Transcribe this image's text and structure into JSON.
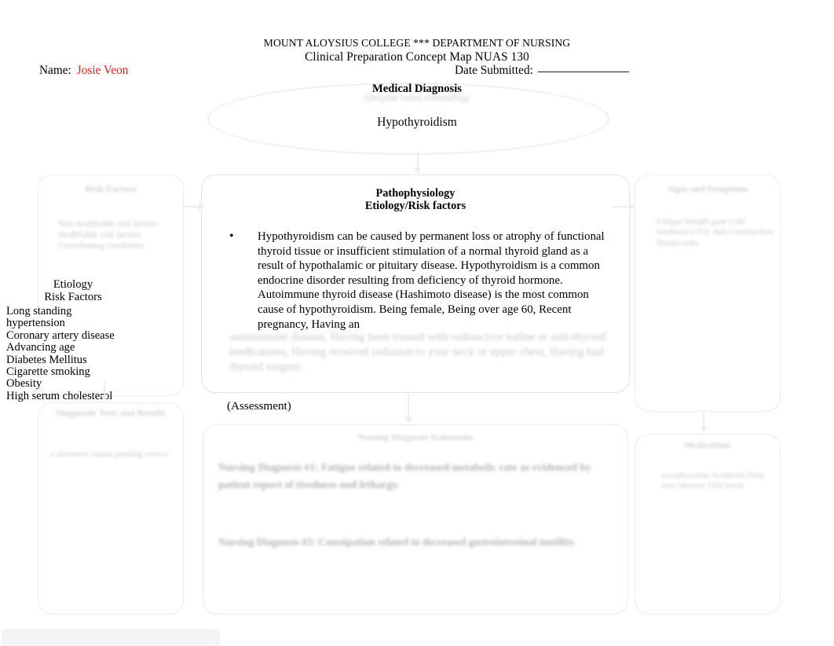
{
  "document": {
    "org_line": "MOUNT ALOYSIUS COLLEGE *** DEPARTMENT OF NURSING",
    "title_line": "Clinical Preparation Concept Map NUAS 130",
    "name_label": "Name:",
    "name_value": "Josie Veon",
    "date_label": "Date Submitted:",
    "date_value": ""
  },
  "diagnosis": {
    "heading": "Medical Diagnosis",
    "subheading_faded": "(illegible faded subheading)",
    "value": "Hypothyroidism"
  },
  "pathophysiology": {
    "heading_line1": "Pathophysiology",
    "heading_line2": "Etiology/Risk factors",
    "bullet_glyph": "•",
    "body": " Hypothyroidism can be caused by permanent loss or atrophy of functional thyroid tissue or insufficient stimulation of a normal thyroid gland as a result of hypothalamic or pituitary disease. Hypothyroidism is a common endocrine disorder resulting from deficiency of thyroid hormone. Autoimmune thyroid disease (Hashimoto disease) is the most common cause of hypothyroidism. Being female, Being over age 60, Recent pregnancy, Having an",
    "body_faded_tail": "autoimmune disease, Having been treated with radioactive iodine or anti-thyroid medications, Having received radiation to your neck or upper chest, Having had thyroid surgery."
  },
  "etiology_box": {
    "faded_heading": "Risk Factors",
    "faded_body": "Non modifiable risk factors Modifiable risk factors Contributing conditions",
    "title_line1": "Etiology",
    "title_line2": "Risk Factors",
    "items": [
      "Long standing",
      "hypertension",
      "Coronary artery disease",
      "Advancing age",
      "Diabetes Mellitus",
      "Cigarette smoking",
      "Obesity",
      "High serum cholesterol"
    ]
  },
  "left_lower_box": {
    "faded_heading": "Diagnostic Tests and Results",
    "faded_body": "Laboratory values pending review"
  },
  "right_upper_box": {
    "faded_heading": "Signs and Symptoms",
    "faded_body": "Fatigue Weight gain Cold intolerance Dry skin Constipation Bradycardia"
  },
  "right_lower_box": {
    "faded_heading": "Medications",
    "faded_body": "Levothyroxine Synthroid Daily dose Monitor TSH levels"
  },
  "bottom_center_box": {
    "faded_heading": "Nursing Diagnosis Statements",
    "faded_paragraph_1": "Nursing Diagnosis #1: Fatigue related to decreased metabolic rate as evidenced by patient report of tiredness and lethargy.",
    "faded_paragraph_2": "Nursing Diagnosis #2: Constipation related to decreased gastrointestinal motility."
  },
  "assessment_label": "(Assessment)",
  "colors": {
    "name_value": "#e01b1b",
    "text": "#000000",
    "box_border": "#e3e3e3",
    "faded_text": "#c9c9c9",
    "page_background": "#ffffff"
  }
}
